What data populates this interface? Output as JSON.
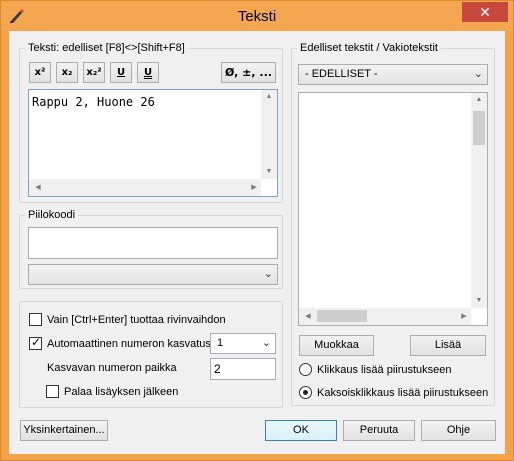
{
  "window": {
    "title": "Teksti",
    "close_glyph": "✕"
  },
  "text_group": {
    "label": "Teksti:  edelliset [F8]<>[Shift+F8]",
    "format_buttons": [
      {
        "label": "x²",
        "icon": "superscript-icon"
      },
      {
        "label": "x₂",
        "icon": "subscript-icon"
      },
      {
        "label": "x₂²",
        "icon": "sub-superscript-icon"
      },
      {
        "label": "U",
        "icon": "underline-icon"
      },
      {
        "label": "U",
        "icon": "double-underline-icon"
      }
    ],
    "symbols_button": "Ø, ±, ...",
    "text_value": "Rappu 2, Huone 26"
  },
  "hidden_code": {
    "label": "Piilokoodi",
    "value": "",
    "combo_value": ""
  },
  "options": {
    "ctrl_enter": {
      "label": "Vain [Ctrl+Enter] tuottaa rivinvaihdon",
      "checked": false
    },
    "auto_increment": {
      "label": "Automaattinen numeron kasvatus",
      "checked": true,
      "value": "1"
    },
    "increment_position": {
      "label": "Kasvavan numeron paikka",
      "value": "2"
    },
    "return_after_add": {
      "label": "Palaa lisäyksen jälkeen",
      "checked": false
    }
  },
  "previous_texts": {
    "label": "Edelliset tekstit / Vakiotekstit",
    "dropdown_value": "- EDELLISET -",
    "edit_button": "Muokkaa",
    "add_button": "Lisää",
    "radio_click": {
      "label": "Klikkaus lisää piirustukseen",
      "selected": false
    },
    "radio_double_click": {
      "label": "Kaksoisklikkaus lisää piirustukseen",
      "selected": true
    }
  },
  "bottom_buttons": {
    "simplify": "Yksinkertainen...",
    "ok": "OK",
    "cancel": "Peruuta",
    "help": "Ohje"
  },
  "colors": {
    "titlebar": "#f5a650",
    "close_button": "#c7493d",
    "dialog_bg": "#f0f0f0"
  }
}
